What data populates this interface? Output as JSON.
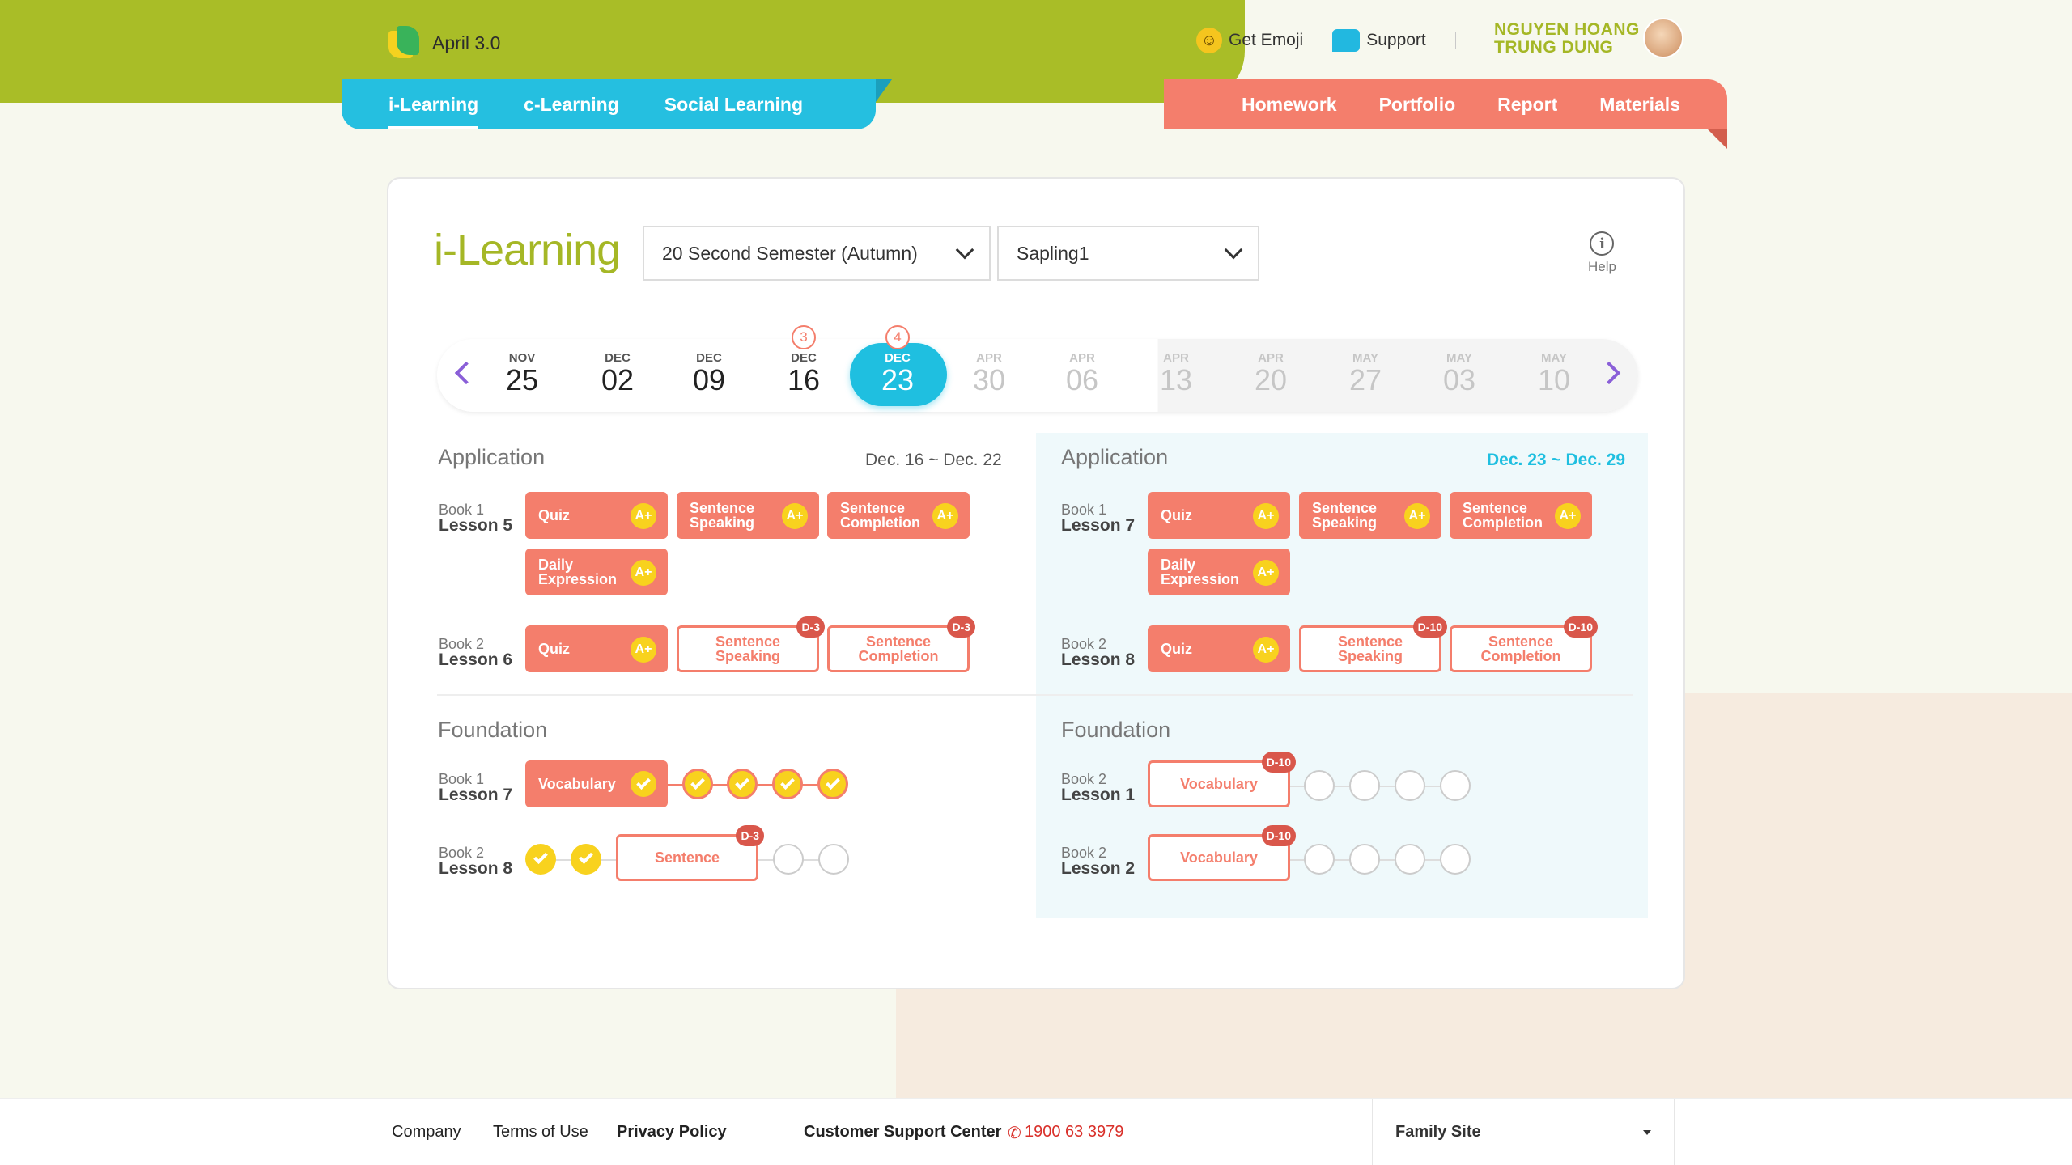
{
  "app": {
    "name": "April 3.0"
  },
  "header": {
    "get_emoji": "Get Emoji",
    "support": "Support",
    "user_name_line1": "NGUYEN HOANG",
    "user_name_line2": "TRUNG DUNG"
  },
  "tabs_left": [
    "i-Learning",
    "c-Learning",
    "Social Learning"
  ],
  "tabs_right": [
    "Homework",
    "Portfolio",
    "Report",
    "Materials"
  ],
  "page": {
    "title": "i-Learning",
    "semester": "20 Second Semester (Autumn)",
    "level": "Sapling1",
    "help": "Help"
  },
  "dates": [
    {
      "month": "NOV",
      "day": "25"
    },
    {
      "month": "DEC",
      "day": "02"
    },
    {
      "month": "DEC",
      "day": "09"
    },
    {
      "month": "DEC",
      "day": "16",
      "count": "3"
    },
    {
      "month": "DEC",
      "day": "23",
      "count": "4"
    },
    {
      "month": "APR",
      "day": "30"
    },
    {
      "month": "APR",
      "day": "06"
    },
    {
      "month": "APR",
      "day": "13"
    },
    {
      "month": "APR",
      "day": "20"
    },
    {
      "month": "MAY",
      "day": "27"
    },
    {
      "month": "MAY",
      "day": "03"
    },
    {
      "month": "MAY",
      "day": "10"
    }
  ],
  "left": {
    "application": "Application",
    "range": "Dec. 16 ~ Dec. 22",
    "rows": [
      {
        "book": "Book 1",
        "lesson": "Lesson 5"
      },
      {
        "book": "Book 2",
        "lesson": "Lesson 6"
      }
    ],
    "foundation": "Foundation",
    "frows": [
      {
        "book": "Book 1",
        "lesson": "Lesson 7"
      },
      {
        "book": "Book 2",
        "lesson": "Lesson 8"
      }
    ]
  },
  "right": {
    "application": "Application",
    "range": "Dec. 23 ~ Dec. 29",
    "rows": [
      {
        "book": "Book 1",
        "lesson": "Lesson 7"
      },
      {
        "book": "Book 2",
        "lesson": "Lesson 8"
      }
    ],
    "foundation": "Foundation",
    "frows": [
      {
        "book": "Book 2",
        "lesson": "Lesson 1"
      },
      {
        "book": "Book 2",
        "lesson": "Lesson 2"
      }
    ]
  },
  "activities": {
    "quiz": "Quiz",
    "sentence_speaking": "Sentence\nSpeaking",
    "sentence_completion": "Sentence\nCompletion",
    "daily_expression": "Daily\nExpression",
    "vocabulary": "Vocabulary",
    "sentence": "Sentence",
    "grade": "A+",
    "d3": "D-3",
    "d10": "D-10"
  },
  "footer": {
    "company": "Company",
    "terms": "Terms of Use",
    "privacy": "Privacy Policy",
    "support_center": "Customer Support Center",
    "phone": "1900 63 3979",
    "family_site": "Family Site"
  },
  "colors": {
    "green": "#a9bd27",
    "cyan": "#1fbfe0",
    "coral": "#f47e6c",
    "yellow": "#f8d21e"
  }
}
